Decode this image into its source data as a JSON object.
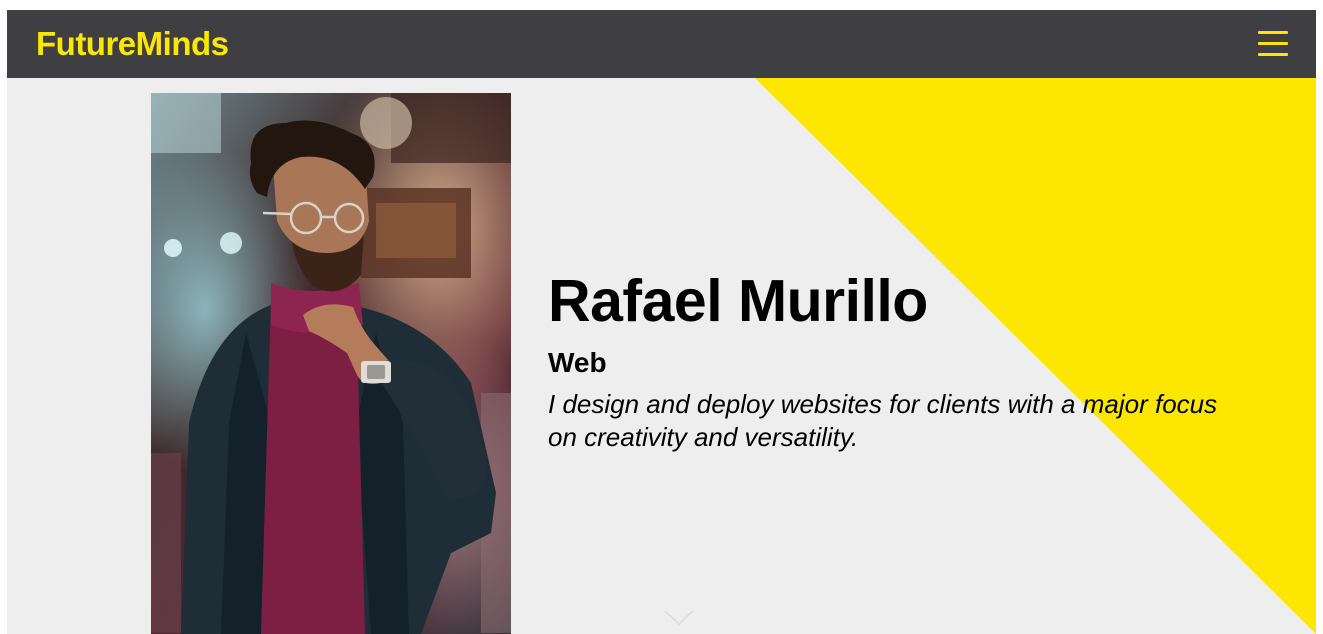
{
  "navbar": {
    "brand": "FutureMinds",
    "menu_icon": "hamburger-menu-icon",
    "background": "#3f3e43",
    "accent": "#fde700"
  },
  "hero": {
    "name": "Rafael Murillo",
    "role": "Web",
    "description": "I design and deploy websites for clients with a major focus on creativity and versatility.",
    "portrait_icon": "portrait-photo",
    "scroll_icon": "chevron-down-icon",
    "background": "#eeeeee",
    "triangle_color": "#fde700"
  }
}
